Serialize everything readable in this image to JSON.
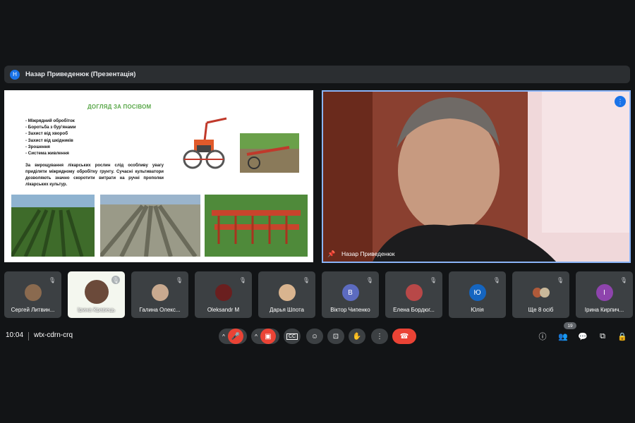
{
  "presentation_bar": {
    "avatar_letter": "Н",
    "title": "Назар Приведенюк (Презентація)"
  },
  "slide": {
    "title": "ДОГЛЯД ЗА ПОСІВОМ",
    "list": [
      "Міжрядний обробіток",
      "Боротьба з бур'янами",
      "Захист від хвороб",
      "Захист від шкідників",
      "Зрошення",
      "Система живлення"
    ],
    "paragraph": "За вирощування лікарських рослин слід особливу увагу приділяти міжрядному обробітку грунту. Сучасні культиватори дозволяють значно скоротити витрати на ручні прополки лікарських культур."
  },
  "speaker": {
    "name": "Назар Приведенюк",
    "more_icon": "more-vert-icon",
    "pin_icon": "pin-icon"
  },
  "participants": [
    {
      "name": "Сергей Литвин...",
      "type": "photo",
      "color": "#8a6a4f"
    },
    {
      "name": "Ірина Кравець",
      "type": "video",
      "color": "#cfe3c0"
    },
    {
      "name": "Галина Олекс...",
      "type": "photo",
      "color": "#c8a98f"
    },
    {
      "name": "Oleksandr M",
      "type": "photo",
      "color": "#6a1f1f"
    },
    {
      "name": "Дарья Шпота",
      "type": "photo",
      "color": "#d9b48f"
    },
    {
      "name": "Віктор Чипенко",
      "type": "letter",
      "letter": "В",
      "color": "#5c6bc0"
    },
    {
      "name": "Елена Бордюг...",
      "type": "photo",
      "color": "#b84848"
    },
    {
      "name": "Юлія",
      "type": "letter",
      "letter": "Ю",
      "color": "#1565c0"
    },
    {
      "name": "Ще 8 осіб",
      "type": "group",
      "color": "#9e7a5a"
    },
    {
      "name": "Ірина Кирпич...",
      "type": "letter",
      "letter": "І",
      "color": "#8e44ad"
    }
  ],
  "bottom": {
    "time": "10:04",
    "meeting_code": "wtx-cdrn-crq",
    "participants_count": "19"
  },
  "colors": {
    "background": "#121416",
    "tile": "#3c4043",
    "accent": "#8ab4f8",
    "end_call": "#ea4335"
  }
}
